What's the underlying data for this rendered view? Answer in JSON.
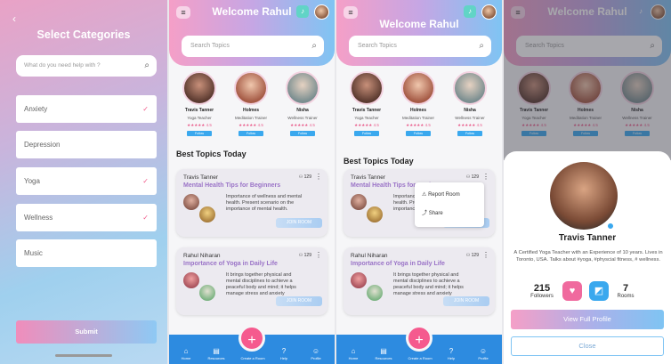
{
  "categories_screen": {
    "title": "Select Categories",
    "search_placeholder": "What do you need help with ?",
    "items": [
      {
        "label": "Anxiety",
        "checked": true
      },
      {
        "label": "Depression",
        "checked": false
      },
      {
        "label": "Yoga",
        "checked": true
      },
      {
        "label": "Wellness",
        "checked": true
      },
      {
        "label": "Music",
        "checked": false
      }
    ],
    "submit_label": "Submit"
  },
  "home": {
    "welcome": "Welcome Rahul",
    "search_placeholder": "Search Topics",
    "trainers": [
      {
        "name": "Travis Tanner",
        "role": "Yoga Teacher",
        "rating": "★★★★★ 4.5",
        "follow": "Follow"
      },
      {
        "name": "Holmes",
        "role": "Meditation Trainer",
        "rating": "★★★★★ 4.5",
        "follow": "Follow"
      },
      {
        "name": "Nisha",
        "role": "Wellness Trainer",
        "rating": "★★★★★ 4.5",
        "follow": "Follow"
      }
    ],
    "best_topics_title": "Best Topics Today",
    "topics": [
      {
        "author": "Travis Tanner",
        "count": "129",
        "title": "Mental Health Tips for Beginners",
        "desc": "Importance of wellness and mental health. Present scenario on the importance of mental health.",
        "join": "JOIN ROOM"
      },
      {
        "author": "Rahul Niharan",
        "count": "129",
        "title": "Importance of Yoga in Daily Life",
        "desc": "It brings together physical and mental disciplines to achieve a peaceful body and mind; it helps manage stress and anxiety",
        "join": "JOIN ROOM"
      }
    ],
    "tabs": [
      {
        "label": "Home",
        "icon": "home-icon"
      },
      {
        "label": "Resources",
        "icon": "book-icon"
      },
      {
        "label": "Create a Room",
        "icon": "plus-icon"
      },
      {
        "label": "Help",
        "icon": "help-icon"
      },
      {
        "label": "Profile",
        "icon": "user-icon"
      }
    ],
    "fab_symbol": "+"
  },
  "popup_menu": {
    "report": "Report Room",
    "share": "Share"
  },
  "profile_sheet": {
    "name": "Travis Tanner",
    "bio": "A Certified Yoga Teacher with an Experience of 10 years. Lives in Toronto, USA. Talks about #yoga, #physcial fitness, # wellness.",
    "followers_count": "215",
    "followers_label": "Followers",
    "rooms_count": "7",
    "rooms_label": "Rooms",
    "view_profile": "View Full Profile",
    "close": "Close"
  }
}
